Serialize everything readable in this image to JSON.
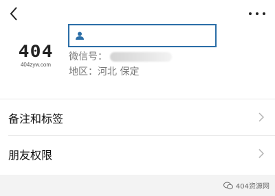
{
  "header": {
    "back_icon": "chevron-left-icon",
    "more_icon": "more-horizontal-icon"
  },
  "profile": {
    "avatar": {
      "logo_text": "404",
      "caption": "404zyw.com"
    },
    "name_box_icon": "user-icon",
    "wechat_id_label": "微信号：",
    "region_text": "地区：河北 保定"
  },
  "menu": {
    "items": [
      {
        "label": "备注和标签",
        "icon": "chevron-right-icon"
      },
      {
        "label": "朋友权限",
        "icon": "chevron-right-icon"
      }
    ]
  },
  "watermark": {
    "text": "404资源网",
    "icon": "wechat-logo-icon"
  },
  "colors": {
    "accent": "#2b6ea7",
    "secondary_text": "#7a7a7a",
    "page_background": "#f3f3f3"
  }
}
